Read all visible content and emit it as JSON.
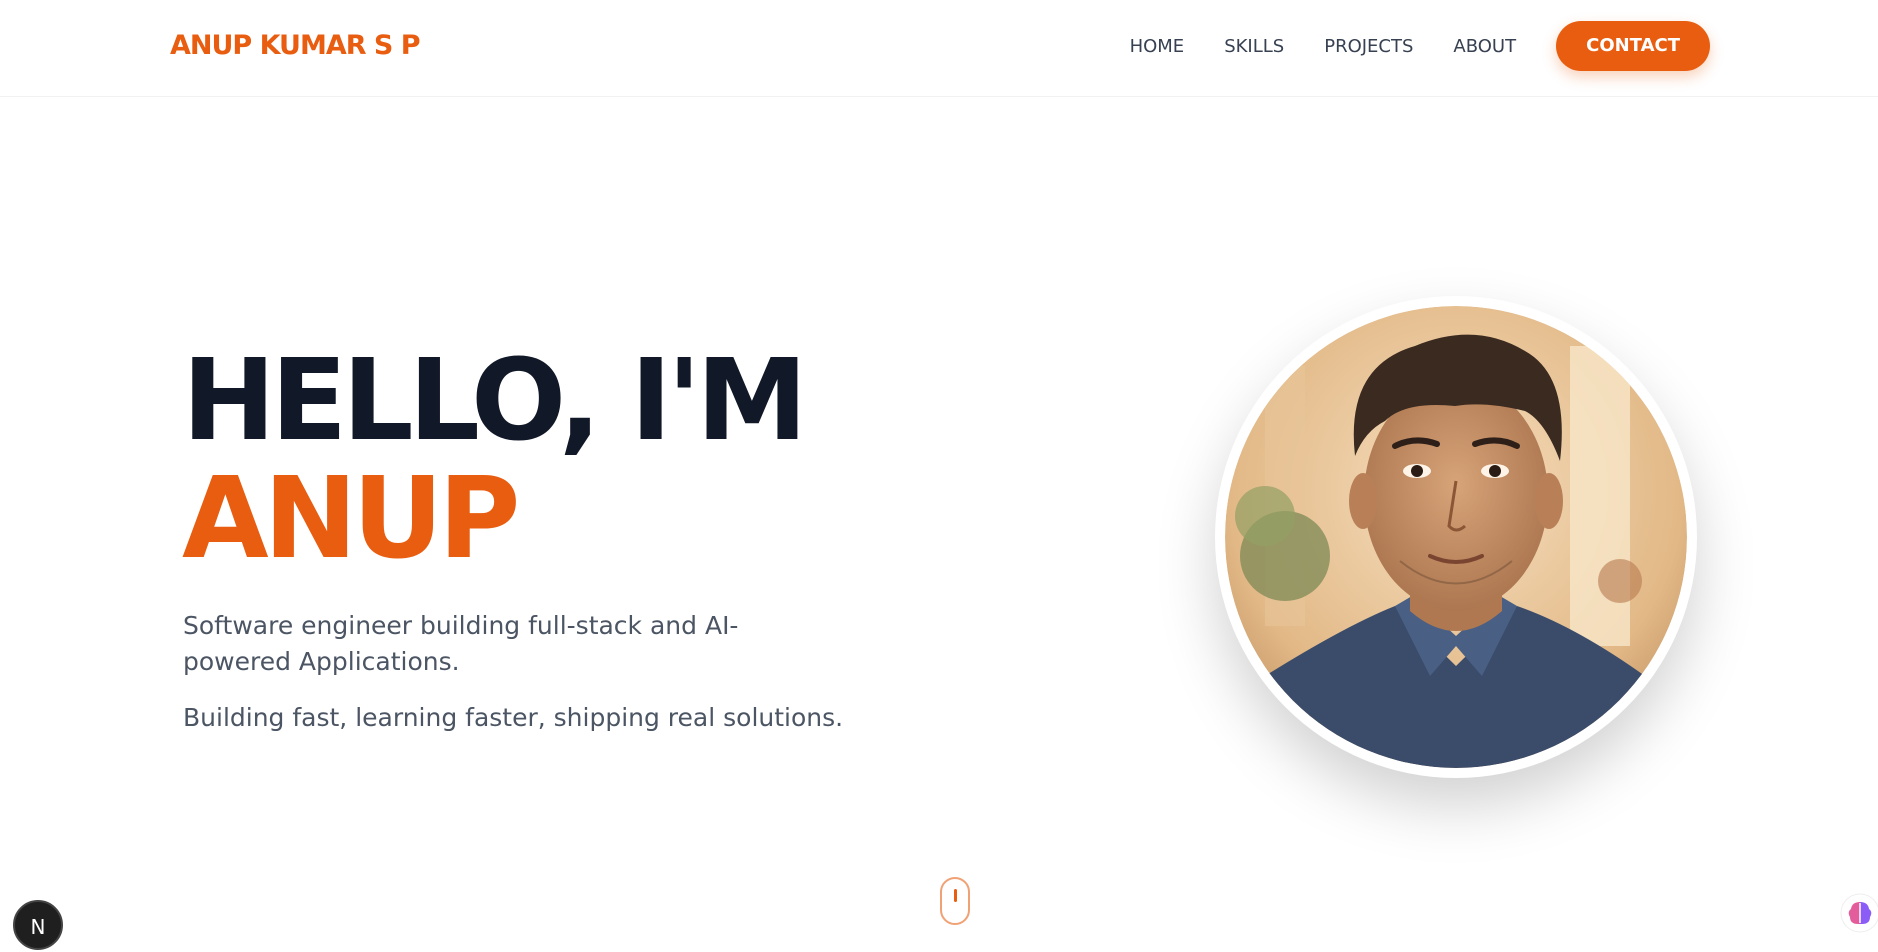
{
  "header": {
    "logo": "ANUP KUMAR S P",
    "nav": [
      {
        "label": "HOME"
      },
      {
        "label": "SKILLS"
      },
      {
        "label": "PROJECTS"
      },
      {
        "label": "ABOUT"
      }
    ],
    "contact_label": "CONTACT"
  },
  "hero": {
    "greeting": "HELLO, I'M",
    "name": "ANUP",
    "tagline": "Software engineer building full-stack and AI-powered Applications.",
    "sub_tagline": "Building fast, learning faster, shipping real solutions."
  },
  "floating": {
    "next_badge": "N",
    "scroll_icon": "mouse-scroll-icon",
    "assistant_icon": "brain-icon"
  },
  "colors": {
    "accent": "#e85d10",
    "heading": "#111827",
    "body_text": "#4b5563"
  }
}
